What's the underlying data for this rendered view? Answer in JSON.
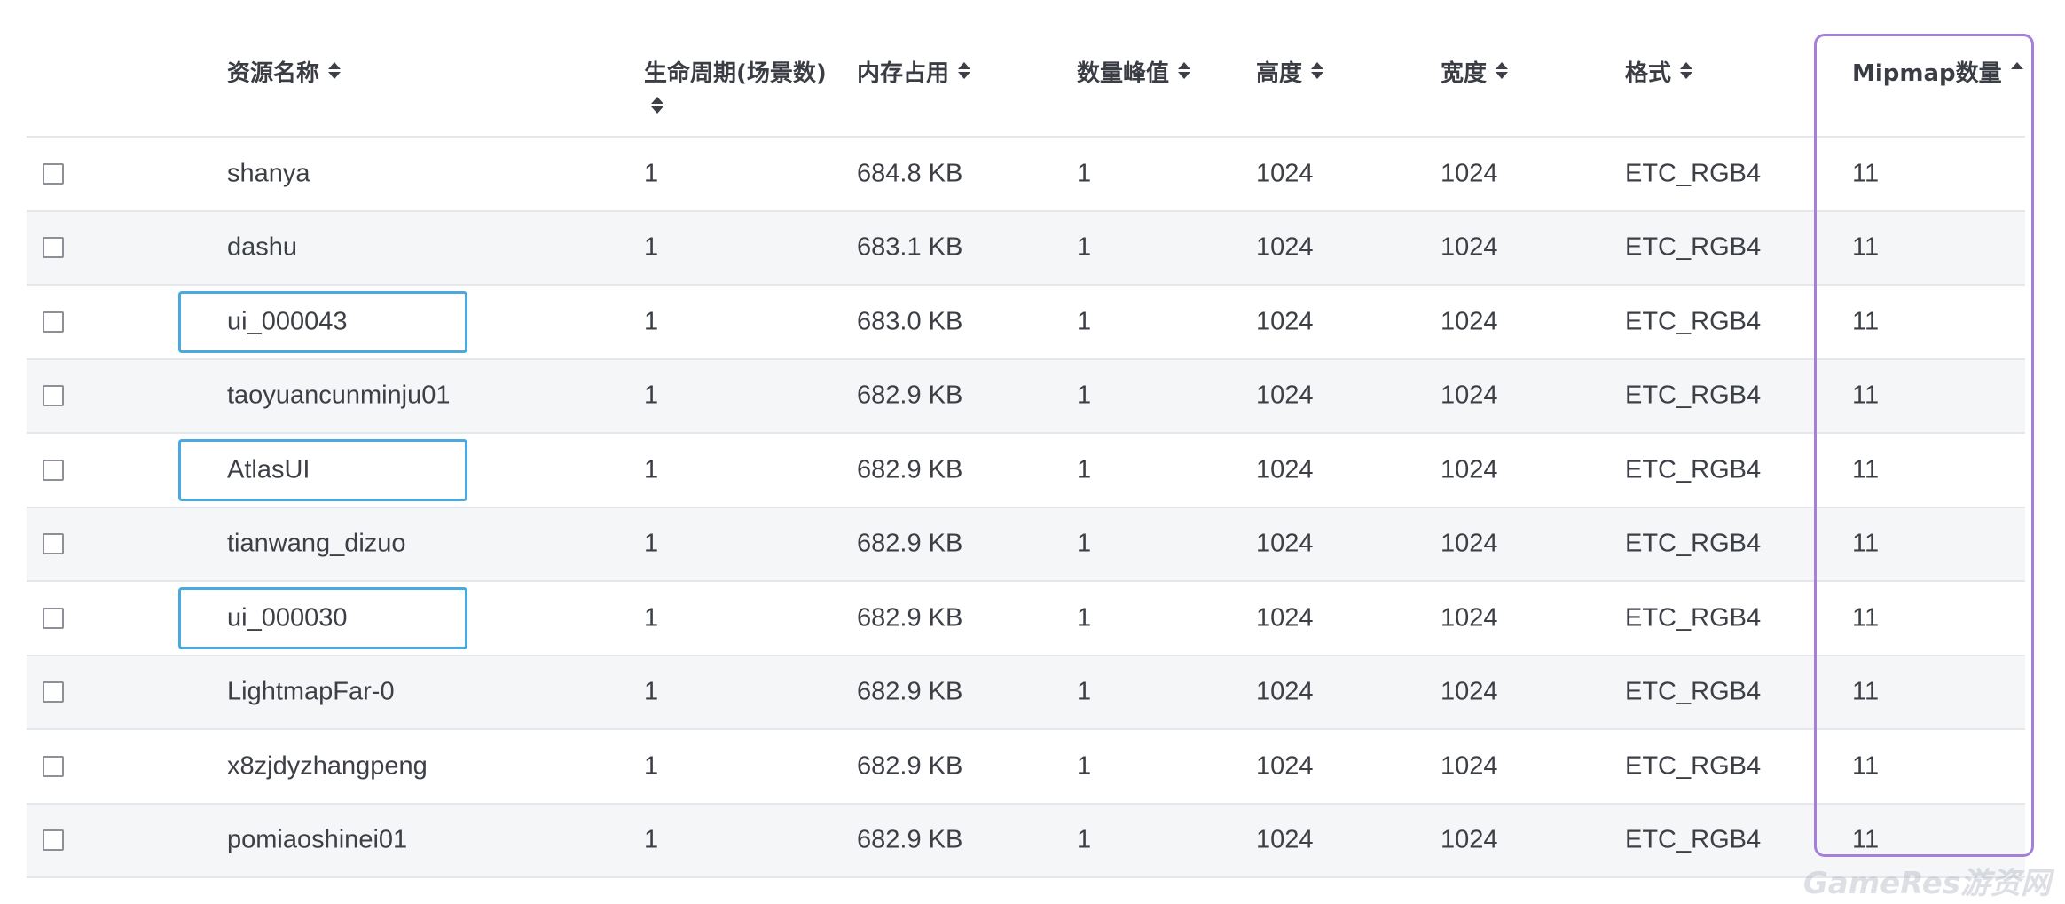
{
  "columns": {
    "name": "资源名称",
    "lifecycle": "生命周期(场景数)",
    "memory": "内存占用",
    "peak": "数量峰值",
    "height": "高度",
    "width": "宽度",
    "format": "格式",
    "mipmap": "Mipmap数量"
  },
  "rows": [
    {
      "name": "shanya",
      "lifecycle": "1",
      "memory": "684.8 KB",
      "peak": "1",
      "height": "1024",
      "width": "1024",
      "format": "ETC_RGB4",
      "mipmap": "11"
    },
    {
      "name": "dashu",
      "lifecycle": "1",
      "memory": "683.1 KB",
      "peak": "1",
      "height": "1024",
      "width": "1024",
      "format": "ETC_RGB4",
      "mipmap": "11"
    },
    {
      "name": "ui_000043",
      "lifecycle": "1",
      "memory": "683.0 KB",
      "peak": "1",
      "height": "1024",
      "width": "1024",
      "format": "ETC_RGB4",
      "mipmap": "11"
    },
    {
      "name": "taoyuancunminju01",
      "lifecycle": "1",
      "memory": "682.9 KB",
      "peak": "1",
      "height": "1024",
      "width": "1024",
      "format": "ETC_RGB4",
      "mipmap": "11"
    },
    {
      "name": "AtlasUI",
      "lifecycle": "1",
      "memory": "682.9 KB",
      "peak": "1",
      "height": "1024",
      "width": "1024",
      "format": "ETC_RGB4",
      "mipmap": "11"
    },
    {
      "name": "tianwang_dizuo",
      "lifecycle": "1",
      "memory": "682.9 KB",
      "peak": "1",
      "height": "1024",
      "width": "1024",
      "format": "ETC_RGB4",
      "mipmap": "11"
    },
    {
      "name": "ui_000030",
      "lifecycle": "1",
      "memory": "682.9 KB",
      "peak": "1",
      "height": "1024",
      "width": "1024",
      "format": "ETC_RGB4",
      "mipmap": "11"
    },
    {
      "name": "LightmapFar-0",
      "lifecycle": "1",
      "memory": "682.9 KB",
      "peak": "1",
      "height": "1024",
      "width": "1024",
      "format": "ETC_RGB4",
      "mipmap": "11"
    },
    {
      "name": "x8zjdyzhangpeng",
      "lifecycle": "1",
      "memory": "682.9 KB",
      "peak": "1",
      "height": "1024",
      "width": "1024",
      "format": "ETC_RGB4",
      "mipmap": "11"
    },
    {
      "name": "pomiaoshinei01",
      "lifecycle": "1",
      "memory": "682.9 KB",
      "peak": "1",
      "height": "1024",
      "width": "1024",
      "format": "ETC_RGB4",
      "mipmap": "11"
    }
  ],
  "highlighted_rows": [
    "ui_000043",
    "AtlasUI",
    "ui_000030"
  ],
  "sort": {
    "column": "mipmap",
    "direction": "asc"
  },
  "colors": {
    "row_highlight": "#4aa9de",
    "column_highlight": "#a57fd9",
    "alt_row": "#f5f6f7"
  },
  "watermark": "GameRes游资网"
}
